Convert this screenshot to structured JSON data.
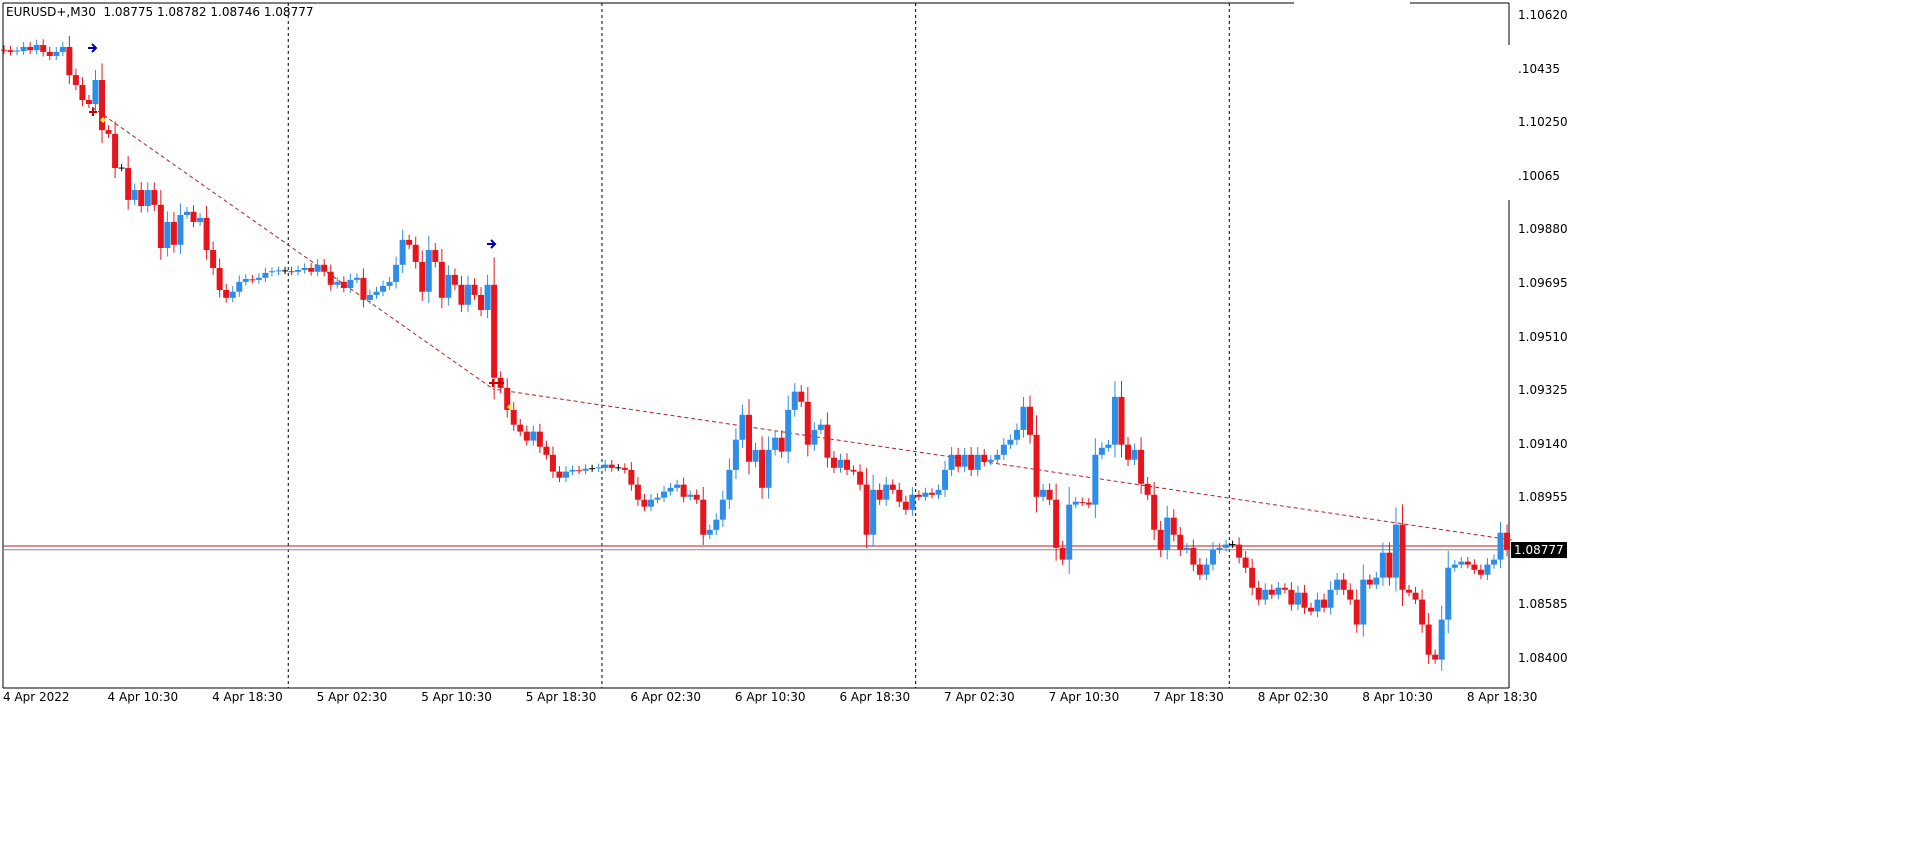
{
  "header": {
    "symbol": "EURUSD+,M30",
    "open": "1.08775",
    "high": "1.08782",
    "low": "1.08746",
    "close": "1.08777"
  },
  "current_price_label": "1.08777",
  "colors": {
    "bull": "#2e8de6",
    "bear": "#e8141b",
    "doji": "#000000",
    "trendline": "#b22222",
    "bid_line": "#b22222",
    "ask_line": "#8c8c8c"
  },
  "chart_data": {
    "type": "candlestick",
    "title": "EURUSD+,M30",
    "ylim": [
      1.084,
      1.1062
    ],
    "y_ticks": [
      "1.10620",
      ".10435",
      "1.10250",
      ".10065",
      "1.09880",
      "1.09695",
      "1.09510",
      "1.09325",
      "1.09140",
      "1.08955",
      "1.08585",
      "1.08400"
    ],
    "y_tick_values": [
      1.1062,
      1.10435,
      1.1025,
      1.10065,
      1.0988,
      1.09695,
      1.0951,
      1.09325,
      1.0914,
      1.08955,
      1.08585,
      1.084
    ],
    "x_ticks": [
      "4 Apr 2022",
      "4 Apr 10:30",
      "4 Apr 18:30",
      "5 Apr 02:30",
      "5 Apr 10:30",
      "5 Apr 18:30",
      "6 Apr 02:30",
      "6 Apr 10:30",
      "6 Apr 18:30",
      "7 Apr 02:30",
      "7 Apr 10:30",
      "7 Apr 18:30",
      "8 Apr 02:30",
      "8 Apr 10:30",
      "8 Apr 18:30"
    ],
    "bars_per_x_tick": 16,
    "day_separator_bars": [
      43.5,
      91.5,
      139.5,
      187.5
    ],
    "first_open": 1.10505,
    "closes": [
      1.10502,
      1.10496,
      1.10499,
      1.10513,
      1.10502,
      1.1052,
      1.10496,
      1.10482,
      1.10496,
      1.10513,
      1.10416,
      1.10382,
      1.1033,
      1.10316,
      1.10399,
      1.10226,
      1.10213,
      1.10095,
      1.10095,
      1.09985,
      1.10019,
      1.09964,
      1.10019,
      1.09968,
      1.09819,
      1.09909,
      1.0983,
      1.09933,
      1.09944,
      1.09909,
      1.09923,
      1.09812,
      1.0975,
      1.09674,
      1.09647,
      1.09668,
      1.09702,
      1.09712,
      1.09709,
      1.09716,
      1.09733,
      1.09737,
      1.0974,
      1.0974,
      1.09737,
      1.09743,
      1.0975,
      1.09737,
      1.09761,
      1.09737,
      1.09692,
      1.09702,
      1.09681,
      1.09709,
      1.09716,
      1.0964,
      1.09657,
      1.09668,
      1.09688,
      1.09702,
      1.09761,
      1.09847,
      1.0983,
      1.09771,
      1.09668,
      1.09812,
      1.09771,
      1.09647,
      1.09726,
      1.09692,
      1.09623,
      1.09692,
      1.09657,
      1.09605,
      1.09692,
      1.09371,
      1.09336,
      1.0926,
      1.09209,
      1.09185,
      1.09154,
      1.09185,
      1.09133,
      1.09105,
      1.09047,
      1.09026,
      1.09047,
      1.09053,
      1.0905,
      1.09057,
      1.09057,
      1.0906,
      1.09071,
      1.0906,
      1.0906,
      1.09053,
      1.09002,
      1.0895,
      1.08926,
      1.0895,
      1.08957,
      1.08978,
      1.08991,
      1.09002,
      1.0896,
      1.08967,
      1.0895,
      1.08829,
      1.08846,
      1.08881,
      1.0895,
      1.09053,
      1.09157,
      1.09243,
      1.09081,
      1.09122,
      1.08991,
      1.09122,
      1.09164,
      1.09116,
      1.0926,
      1.09323,
      1.09288,
      1.0914,
      1.09191,
      1.09209,
      1.09095,
      1.0906,
      1.09088,
      1.09053,
      1.09047,
      1.09002,
      1.08829,
      1.08984,
      1.0895,
      1.09002,
      1.08984,
      1.08943,
      1.08915,
      1.08967,
      1.0896,
      1.08974,
      1.08967,
      1.08984,
      1.09053,
      1.09105,
      1.09064,
      1.09105,
      1.09053,
      1.09105,
      1.09081,
      1.09088,
      1.09105,
      1.0914,
      1.09157,
      1.09191,
      1.09271,
      1.09174,
      1.0896,
      1.08984,
      1.0895,
      1.08784,
      1.08743,
      1.08933,
      1.08943,
      1.0894,
      1.08933,
      1.09105,
      1.09129,
      1.0914,
      1.09305,
      1.0914,
      1.09088,
      1.09122,
      1.09005,
      1.08967,
      1.08846,
      1.08777,
      1.08888,
      1.08829,
      1.08777,
      1.08784,
      1.08726,
      1.08691,
      1.08726,
      1.08777,
      1.08784,
      1.08795,
      1.08795,
      1.0875,
      1.08715,
      1.08646,
      1.08605,
      1.08639,
      1.08622,
      1.08646,
      1.08639,
      1.08588,
      1.08629,
      1.08577,
      1.08564,
      1.08605,
      1.08577,
      1.08639,
      1.08674,
      1.08639,
      1.08605,
      1.08519,
      1.08674,
      1.08657,
      1.08681,
      1.08767,
      1.08681,
      1.08864,
      1.08639,
      1.08629,
      1.08605,
      1.08519,
      1.08415,
      1.08398,
      1.08536,
      1.08715,
      1.08726,
      1.08736,
      1.08726,
      1.08708,
      1.08691,
      1.08726,
      1.08743,
      1.08836,
      1.08777
    ],
    "trendlines": [
      {
        "from_bar": 13.5,
        "from_price": 1.10305,
        "to_bar": 75,
        "to_price": 1.0933
      },
      {
        "from_bar": 75.5,
        "from_price": 1.0933,
        "to_bar": 231,
        "to_price": 1.0881
      }
    ],
    "bid": 1.08777,
    "ask": 1.0879
  }
}
